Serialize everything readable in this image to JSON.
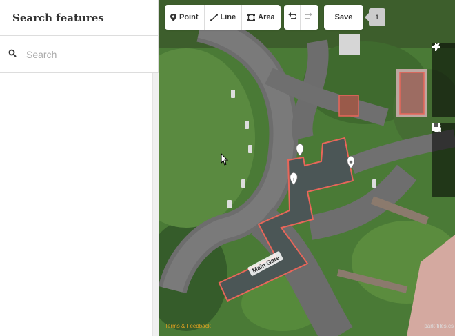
{
  "sidebar": {
    "title": "Search features",
    "search": {
      "placeholder": "Search",
      "value": ""
    }
  },
  "toolbar": {
    "modes": [
      {
        "label": "Point",
        "icon": "marker-icon"
      },
      {
        "label": "Line",
        "icon": "line-icon"
      },
      {
        "label": "Area",
        "icon": "area-icon"
      }
    ],
    "undo_icon": "undo-icon",
    "redo_icon": "redo-icon",
    "save_label": "Save",
    "save_count": "1"
  },
  "map_controls": {
    "zoom": [
      "zoom-in-icon",
      "zoom-out-icon",
      "geolocate-icon"
    ],
    "panels": [
      "layers-icon",
      "map-data-icon",
      "issues-icon"
    ]
  },
  "map": {
    "street_label": "Main Gate",
    "attribution": "Terms & Feedback",
    "attribution_right": "park-files.cs",
    "colors": {
      "grass": "#4f7a3a",
      "road": "#6b6b6b",
      "selected_area_stroke": "#e8665a"
    }
  }
}
